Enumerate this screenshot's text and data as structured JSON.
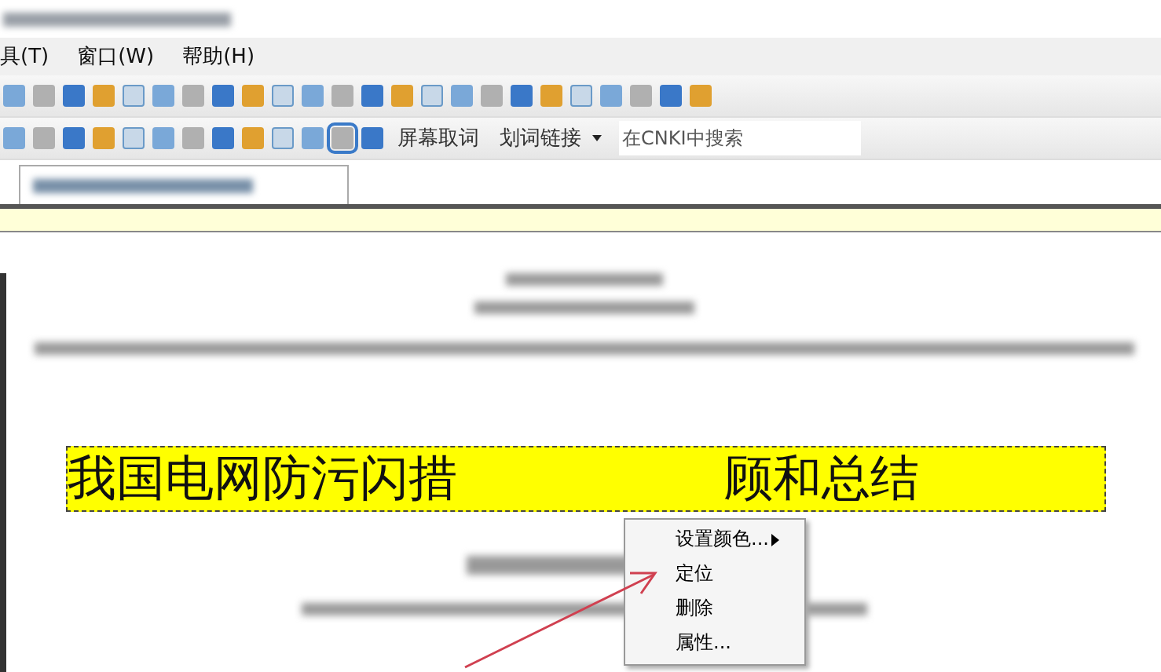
{
  "menu_bar": [
    {
      "label": "具(T)"
    },
    {
      "label": "窗口(W)"
    },
    {
      "label": "帮助(H)"
    }
  ],
  "toolbar": {
    "screen_word_button": "屏幕取词",
    "link_button": "划词链接",
    "search": {
      "placeholder": "在CNKI中搜索"
    },
    "word_select_on": true
  },
  "document": {
    "title_parts": [
      "我国电网防污闪措",
      "顾和总结"
    ]
  },
  "context_menu": {
    "items": [
      {
        "label": "设置颜色...",
        "has_submenu": true
      },
      {
        "label": "定位",
        "has_submenu": false
      },
      {
        "label": "删除",
        "has_submenu": false
      },
      {
        "label": "属性...",
        "has_submenu": false
      }
    ]
  }
}
